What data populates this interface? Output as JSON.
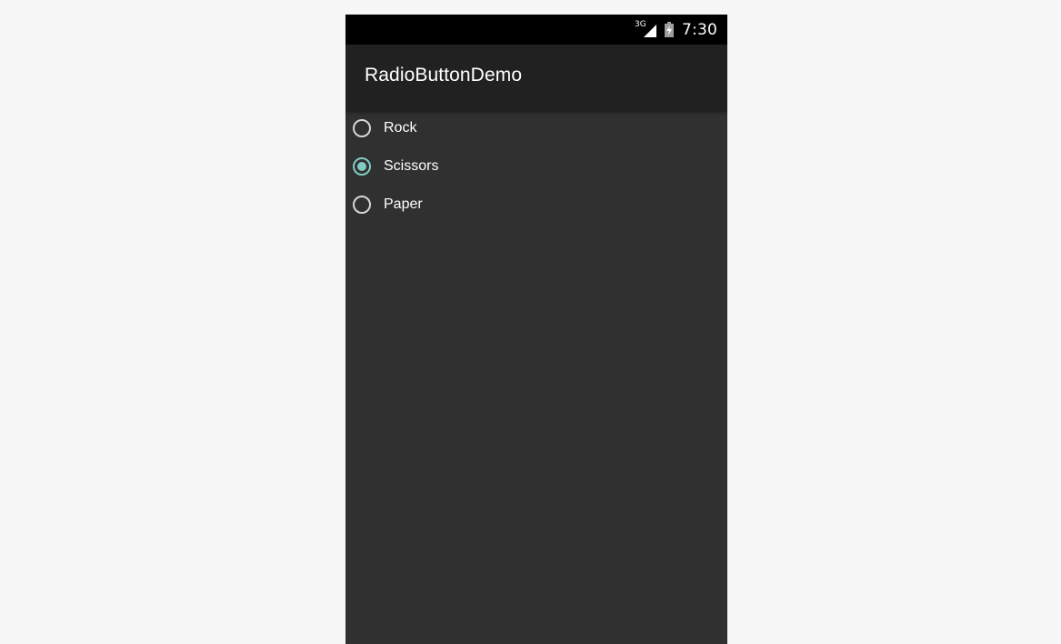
{
  "status_bar": {
    "network_type": "3G",
    "time": "7:30",
    "icons": [
      "signal-icon",
      "battery-charging-icon"
    ]
  },
  "app": {
    "title": "RadioButtonDemo"
  },
  "radio_group": {
    "options": [
      {
        "label": "Rock",
        "checked": false
      },
      {
        "label": "Scissors",
        "checked": true
      },
      {
        "label": "Paper",
        "checked": false
      }
    ]
  },
  "colors": {
    "accent": "#80cbc4",
    "content_background": "#303030",
    "action_bar": "#212121",
    "status_bar": "#000000",
    "page_background": "#f7f7f7"
  }
}
